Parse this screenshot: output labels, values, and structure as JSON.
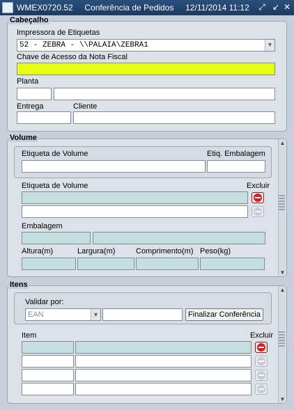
{
  "window": {
    "title": "WMEX0720.52     Conferência de Pedidos     12/11/2014 11:12"
  },
  "cabecalho": {
    "title": "Cabeçalho",
    "impressora_label": "Impressora de Etiquetas",
    "impressora_value": "52 - ZEBRA - \\\\PALAIA\\ZEBRA1",
    "chave_label": "Chave de Acesso da Nota Fiscal",
    "chave_value": "",
    "planta_label": "Planta",
    "entrega_label": "Entrega",
    "cliente_label": "Cliente"
  },
  "volume": {
    "title": "Volume",
    "etiqueta_label": "Etiqueta de Volume",
    "etiq_emb_label": "Etiq. Embalagem",
    "etiqueta_label2": "Etiqueta de Volume",
    "excluir_label": "Excluir",
    "embalagem_label": "Embalagem",
    "altura_label": "Altura(m)",
    "largura_label": "Largura(m)",
    "comprimento_label": "Comprimento(m)",
    "peso_label": "Peso(kg)"
  },
  "itens": {
    "title": "Itens",
    "validar_label": "Validar por:",
    "validar_value": "EAN",
    "finalizar_label": "Finalizar Conferência",
    "item_label": "Item",
    "excluir_label": "Excluir"
  },
  "colors": {
    "title_bar": "#1b3a63",
    "highlight": "#e8ff10",
    "readonly": "#c5dede",
    "delete": "#d62020"
  }
}
